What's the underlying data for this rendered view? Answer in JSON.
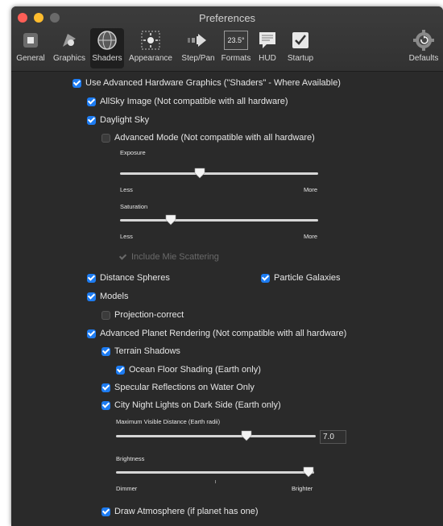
{
  "window": {
    "title": "Preferences"
  },
  "colors": {
    "accent": "#1d7cf2",
    "background": "#2a2a2a",
    "close": "#fe5f57",
    "minimize": "#febc2e",
    "zoom": "#6a6a6a"
  },
  "toolbar": {
    "items": [
      {
        "label": "General",
        "icon": "general-icon"
      },
      {
        "label": "Graphics",
        "icon": "graphics-icon"
      },
      {
        "label": "Shaders",
        "icon": "shaders-icon",
        "selected": true
      },
      {
        "label": "Appearance",
        "icon": "appearance-icon"
      },
      {
        "label": "Step/Pan",
        "icon": "step-pan-icon"
      },
      {
        "label": "Formats",
        "icon": "formats-icon",
        "icon_text": "23.5°"
      },
      {
        "label": "HUD",
        "icon": "hud-icon"
      },
      {
        "label": "Startup",
        "icon": "startup-icon"
      }
    ],
    "defaults_label": "Defaults"
  },
  "shaders": {
    "use_advanced": {
      "label": "Use Advanced Hardware Graphics  (\"Shaders\" - Where Available)",
      "checked": true
    },
    "allsky": {
      "label": "AllSky Image (Not compatible with all hardware)",
      "checked": true
    },
    "daylight": {
      "label": "Daylight Sky",
      "checked": true
    },
    "advanced_mode": {
      "label": "Advanced Mode (Not compatible with all hardware)",
      "checked": false
    },
    "exposure": {
      "label": "Exposure",
      "min_label": "Less",
      "max_label": "More",
      "level": 0.44
    },
    "saturation": {
      "label": "Saturation",
      "min_label": "Less",
      "max_label": "More",
      "level": 0.26
    },
    "mie": {
      "label": "Include Mie Scattering",
      "checked": true,
      "enabled": false
    },
    "distance_spheres": {
      "label": "Distance Spheres",
      "checked": true
    },
    "particle_galaxies": {
      "label": "Particle Galaxies",
      "checked": true
    },
    "models": {
      "label": "Models",
      "checked": true
    },
    "projection_correct": {
      "label": "Projection-correct",
      "checked": false
    },
    "planet_rendering": {
      "label": "Advanced Planet Rendering (Not compatible with all hardware)",
      "checked": true
    },
    "terrain_shadows": {
      "label": "Terrain Shadows",
      "checked": true
    },
    "ocean_floor": {
      "label": "Ocean Floor Shading (Earth only)",
      "checked": true
    },
    "specular": {
      "label": "Specular Reflections on Water Only",
      "checked": true
    },
    "city_lights": {
      "label": "City Night Lights on Dark Side (Earth only)",
      "checked": true
    },
    "max_distance": {
      "label": "Maximum Visible Distance (Earth radii)",
      "value": "7.0",
      "level": 0.65
    },
    "brightness": {
      "label": "Brightness",
      "min_label": "Dimmer",
      "max_label": "Brighter",
      "level": 1.0
    },
    "atmosphere": {
      "label": "Draw Atmosphere (if planet has one)",
      "checked": true
    }
  }
}
